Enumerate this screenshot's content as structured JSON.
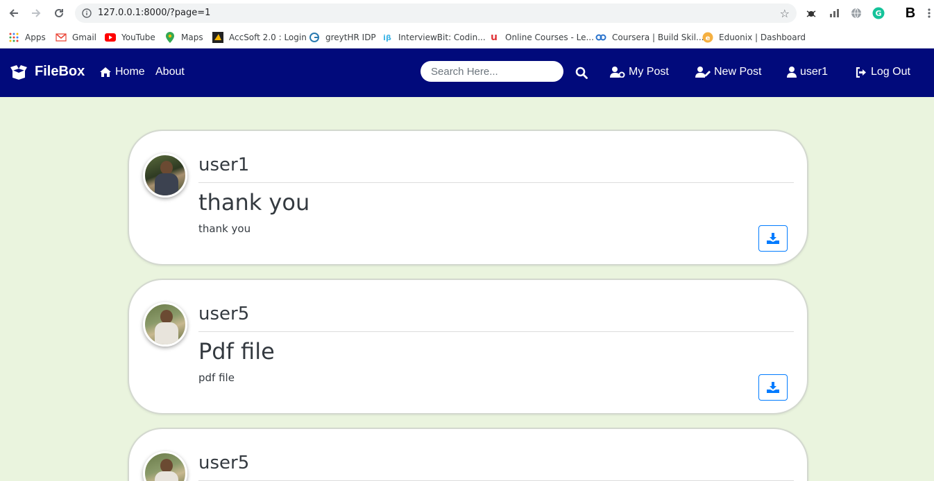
{
  "browser": {
    "url": "127.0.0.1:8000/?page=1",
    "bookmarks": [
      {
        "label": "Apps",
        "icon": "apps-grid-icon"
      },
      {
        "label": "Gmail",
        "icon": "gmail-icon"
      },
      {
        "label": "YouTube",
        "icon": "youtube-icon"
      },
      {
        "label": "Maps",
        "icon": "maps-pin-icon"
      },
      {
        "label": "AccSoft 2.0 : Login",
        "icon": "accsoft-icon"
      },
      {
        "label": "greytHR IDP",
        "icon": "greythr-icon"
      },
      {
        "label": "InterviewBit: Codin...",
        "icon": "interviewbit-icon"
      },
      {
        "label": "Online Courses - Le...",
        "icon": "udemy-icon"
      },
      {
        "label": "Coursera | Build Skil...",
        "icon": "coursera-icon"
      },
      {
        "label": "Eduonix | Dashboard",
        "icon": "eduonix-icon"
      }
    ]
  },
  "navbar": {
    "brand": "FileBox",
    "home": "Home",
    "about": "About",
    "search_placeholder": "Search Here...",
    "my_post": "My Post",
    "new_post": "New Post",
    "user": "user1",
    "logout": "Log Out",
    "bg_color": "#010a7b"
  },
  "posts": [
    {
      "user": "user1",
      "title": "thank you",
      "description": "thank you"
    },
    {
      "user": "user5",
      "title": "Pdf file",
      "description": "pdf file"
    },
    {
      "user": "user5",
      "title": "",
      "description": ""
    }
  ]
}
